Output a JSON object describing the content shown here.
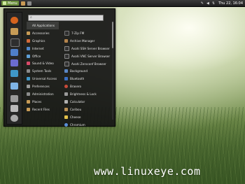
{
  "panel": {
    "menu_label": "Menu",
    "clock": "Thu 22, 16:04",
    "launchers": [
      {
        "name": "launcher-folder",
        "color": "#c99a55"
      },
      {
        "name": "launcher-terminal",
        "color": "#8a8a8a"
      }
    ],
    "tray_icons": [
      "pencil-icon",
      "volume-icon",
      "network-icon"
    ]
  },
  "menu": {
    "search": {
      "placeholder": ""
    },
    "favorites": [
      {
        "name": "firefox-icon",
        "color": "#d5631e"
      },
      {
        "name": "files-icon",
        "color": "#c79b56"
      },
      {
        "name": "terminal-icon",
        "color": "#2e2e2e"
      },
      {
        "name": "mail-icon",
        "color": "#4f7fc9"
      },
      {
        "name": "calendar-icon",
        "color": "#6b6bd0"
      },
      {
        "name": "puzzle-icon",
        "color": "#3f97c8"
      },
      {
        "name": "folder-icon",
        "color": "#7fb4e6"
      },
      {
        "name": "lock-icon",
        "color": "#9a9a9a"
      },
      {
        "name": "logout-icon",
        "color": "#b9b9b9"
      },
      {
        "name": "power-icon",
        "color": "#a9a9a9"
      }
    ],
    "categories": [
      {
        "label": "All Applications",
        "color": "transparent",
        "selected": true
      },
      {
        "label": "Accessories",
        "color": "#c79b56"
      },
      {
        "label": "Graphics",
        "color": "#d46a3a"
      },
      {
        "label": "Internet",
        "color": "#4f86c9"
      },
      {
        "label": "Office",
        "color": "#5fa0d8"
      },
      {
        "label": "Sound & Video",
        "color": "#d84a6a"
      },
      {
        "label": "System Tools",
        "color": "#8a8a8a"
      },
      {
        "label": "Universal Access",
        "color": "#3f97c8"
      },
      {
        "label": "Preferences",
        "color": "#9a9a9a"
      },
      {
        "label": "Administration",
        "color": "#8c8c8c"
      },
      {
        "label": "Places",
        "color": "#c79b56"
      },
      {
        "label": "Recent Files",
        "color": "#c79b56"
      }
    ],
    "apps": [
      {
        "label": "7-Zip FM",
        "color": "#2f2f2f"
      },
      {
        "label": "Archive Manager",
        "color": "#b4844c"
      },
      {
        "label": "Avahi SSH Server Browser",
        "color": "#333333"
      },
      {
        "label": "Avahi VNC Server Browser",
        "color": "#333333"
      },
      {
        "label": "Avahi Zeroconf Browser",
        "color": "#333333"
      },
      {
        "label": "Background",
        "color": "#5a86c4"
      },
      {
        "label": "Bluetooth",
        "color": "#3a6fc4"
      },
      {
        "label": "Brasero",
        "color": "#c84a3a"
      },
      {
        "label": "Brightness & Lock",
        "color": "#9a9a9a"
      },
      {
        "label": "Calculator",
        "color": "#b0b0b0"
      },
      {
        "label": "Caribou",
        "color": "#b98f54"
      },
      {
        "label": "Cheese",
        "color": "#e3c14a"
      },
      {
        "label": "Chromium",
        "color": "#5a8fd8"
      }
    ]
  },
  "watermark": "www.linuxeye.com"
}
